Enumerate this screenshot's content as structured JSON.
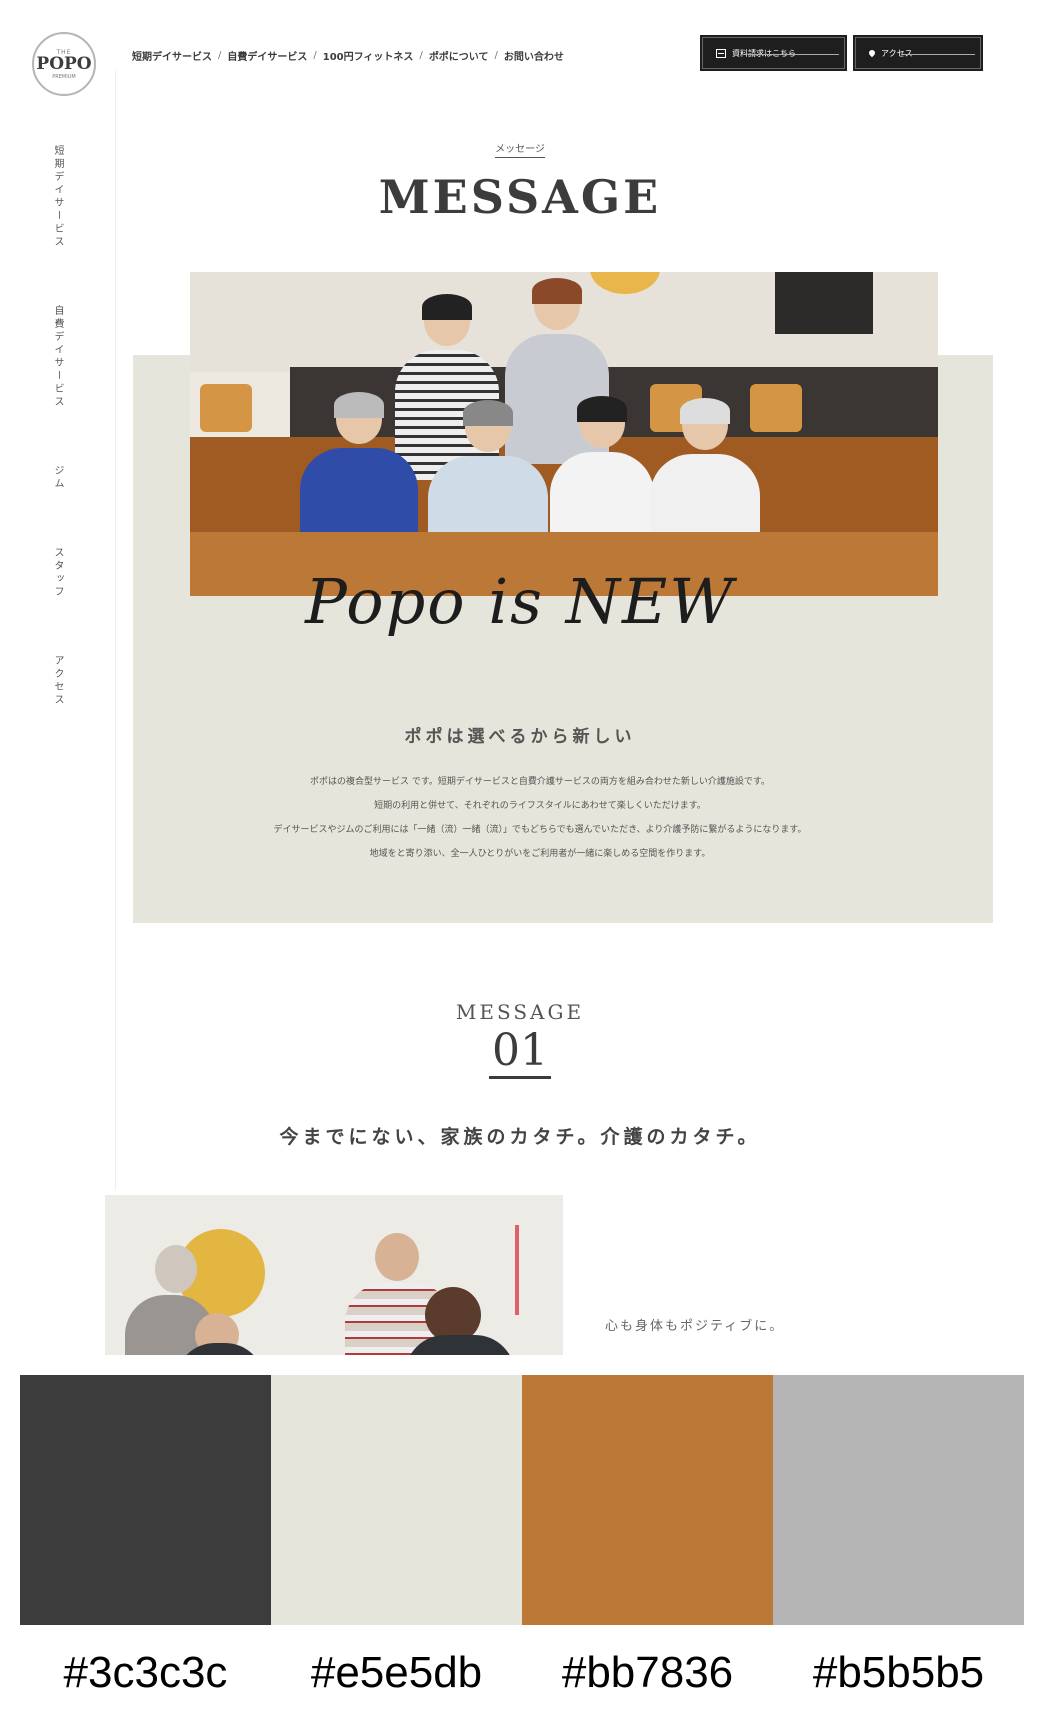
{
  "logo": {
    "top": "THE",
    "main": "POPO",
    "sub": "PREMIUM"
  },
  "topnav": {
    "items": [
      "短期デイサービス",
      "自費デイサービス",
      "100円フィットネス",
      "ポポについて",
      "お問い合わせ"
    ]
  },
  "header_buttons": {
    "document": "資料請求はこちら",
    "map": "アクセス"
  },
  "sidenav": [
    "短期デイサービス",
    "自費デイサービス",
    "ジム",
    "スタッフ",
    "アクセス"
  ],
  "hero": {
    "kicker": "メッセージ",
    "title": "MESSAGE",
    "script": "Popo is NEW",
    "heading": "ポポは選べるから新しい",
    "body": [
      "ポポはの複合型サービス です。短期デイサービスと自費介護サービスの両方を組み合わせた新しい介護施設です。",
      "短期の利用と併せて、それぞれのライフスタイルにあわせて楽しくいただけます。",
      "デイサービスやジムのご利用には「一緒（流）一緒（流）」でもどちらでも選んでいただき、より介護予防に繋がるようになります。",
      "地域をと寄り添い、全一人ひとりがいをご利用者が一緒に楽しめる空間を作ります。"
    ]
  },
  "message": {
    "label": "MESSAGE",
    "number": "01",
    "headline": "今までにない、家族のカタチ。介護のカタチ。",
    "caption": "心も身体もポジティブに。"
  },
  "palette": {
    "colors": [
      "#3c3c3c",
      "#e5e5db",
      "#bb7836",
      "#b5b5b5"
    ],
    "labels": [
      "#3c3c3c",
      "#e5e5db",
      "#bb7836",
      "#b5b5b5"
    ]
  }
}
